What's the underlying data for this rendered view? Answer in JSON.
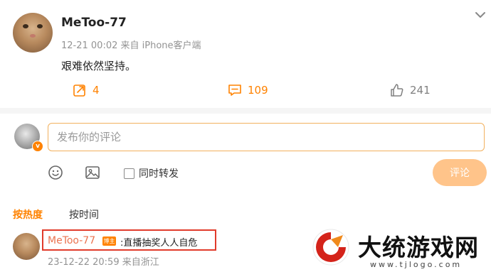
{
  "post": {
    "username": "MeToo-77",
    "meta": "12-21 00:02 来自 iPhone客户端",
    "content": "艰难依然坚持。",
    "repost_count": "4",
    "comment_count": "109",
    "like_count": "241"
  },
  "composer": {
    "placeholder": "发布你的评论",
    "repost_label": "同时转发",
    "submit_label": "评论"
  },
  "sort": {
    "hot_label": "按热度",
    "time_label": "按时间"
  },
  "comment": {
    "username": "MeToo-77",
    "badge": "博主",
    "text": ":直播抽奖人人自危",
    "meta": "23-12-22 20:59 来自浙江"
  },
  "watermark": {
    "title": "大统游戏网",
    "url": "www.tjlogo.com"
  },
  "colors": {
    "accent": "#ff8200",
    "highlight_border": "#e13b2b"
  },
  "icons": [
    "chevron-down-icon",
    "repost-icon",
    "comment-icon",
    "like-icon",
    "emoji-icon",
    "image-icon",
    "verified-icon"
  ]
}
